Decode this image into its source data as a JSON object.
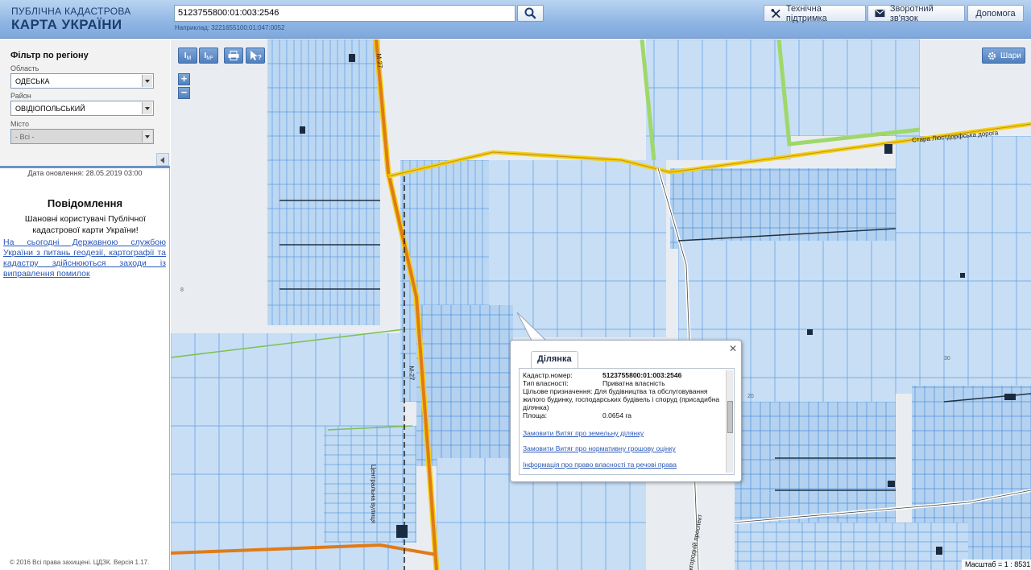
{
  "header": {
    "logo_line1": "ПУБЛІЧНА КАДАСТРОВА",
    "logo_line2": "КАРТА УКРАЇНИ",
    "search_value": "5123755800:01:003:2546",
    "search_hint": "Наприклад: 3221655100:01:047:0052",
    "support_label": "Технічна підтримка",
    "feedback_label": "Зворотний зв'язок",
    "help_label": "Допомога"
  },
  "sidebar": {
    "filter_title": "Фільтр по регіону",
    "oblast_label": "Область",
    "oblast_value": "ОДЕСЬКА",
    "rayon_label": "Район",
    "rayon_value": "ОВІДІОПОЛЬСЬКИЙ",
    "misto_label": "Місто",
    "misto_value": "- Всі -",
    "update_date": "Дата оновлення: 28.05.2019 03:00",
    "news_title": "Повідомлення",
    "news_greeting": "Шановні користувачі Публічної кадастрової карти України!",
    "news_link": "На сьогодні Державною службою України з питань геодезії, картографії та кадастру здійснюються заходи із виправлення помилок",
    "copyright": "© 2016 Всі права захищені. ЦДЗК. Версія 1.17."
  },
  "map": {
    "layers_label": "Шари",
    "scale_label": "Масштаб = 1 : 8531",
    "road_labels": [
      "М-27",
      "М-27",
      "Стара Люстдорфська дорога",
      "Центральна вулиця",
      "Міжгородній проспект"
    ],
    "height_labels": [
      "8",
      "20",
      "30"
    ],
    "tool_measure": "M",
    "tool_measure_area": "M²"
  },
  "popup": {
    "tab_label": "Ділянка",
    "cadastral_label": "Кадастр.номер:",
    "cadastral_value": "5123755800:01:003:2546",
    "ownership_label": "Тип власності:",
    "ownership_value": "Приватна власність",
    "purpose_label": "Цільове призначення:",
    "purpose_value": "Для будівництва та обслуговування жилого будинку, господарських будівель і споруд (присадибна ділянка)",
    "area_label": "Площа:",
    "area_value": "0.0654 га",
    "link1": "Замовити Витяг про земельну ділянку",
    "link2": "Замовити Витяг про нормативну грошову оцінку",
    "link3": "Інформація про право власності та речові права"
  },
  "colors": {
    "parcel_fill": "#bcd7f2",
    "parcel_stroke": "#5b9be0",
    "road_main": "#e07b17",
    "road_yellow": "#f2d019",
    "green_zone": "#9fd86a"
  }
}
